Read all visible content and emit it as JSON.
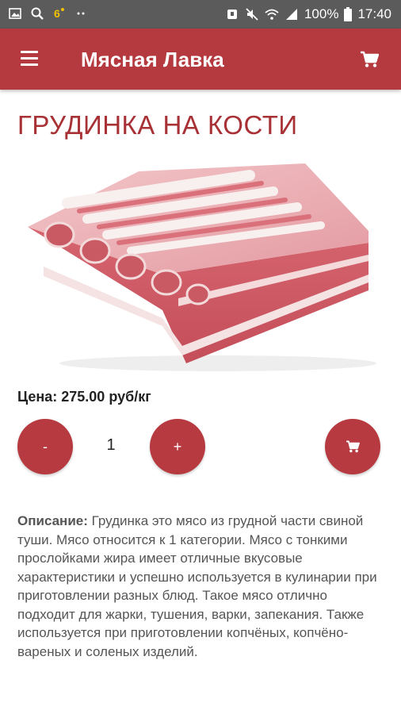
{
  "status_bar": {
    "battery_percent": "100%",
    "time": "17:40",
    "left_icons": [
      "image-icon",
      "search-icon",
      "notification-icon",
      "more-icon"
    ],
    "right_icons": [
      "alarm-icon",
      "mute-icon",
      "wifi-icon",
      "signal-icon",
      "battery-icon"
    ]
  },
  "app_bar": {
    "title": "Мясная Лавка",
    "menu_icon": "hamburger-icon",
    "cart_icon": "cart-icon",
    "color": "#b43a3f"
  },
  "product": {
    "title": "ГРУДИНКА НА КОСТИ",
    "price": "Цена: 275.00 руб/кг",
    "quantity": "1",
    "minus_label": "-",
    "plus_label": "+",
    "description_label": "Описание:",
    "description_text": " Грудинка это мясо из грудной части свиной туши. Мясо относится к 1 категории. Мясо с тонкими прослойками жира имеет отличные вкусовые характеристики и успешно используется в кулинарии при приготовлении разных блюд. Такое мясо отлично подходит для жарки, тушения, варки, запекания. Также используется при приготовлении копчёных, копчёно-вареных и соленых изделий."
  },
  "colors": {
    "accent": "#b43a3f",
    "title_text": "#a83136"
  }
}
